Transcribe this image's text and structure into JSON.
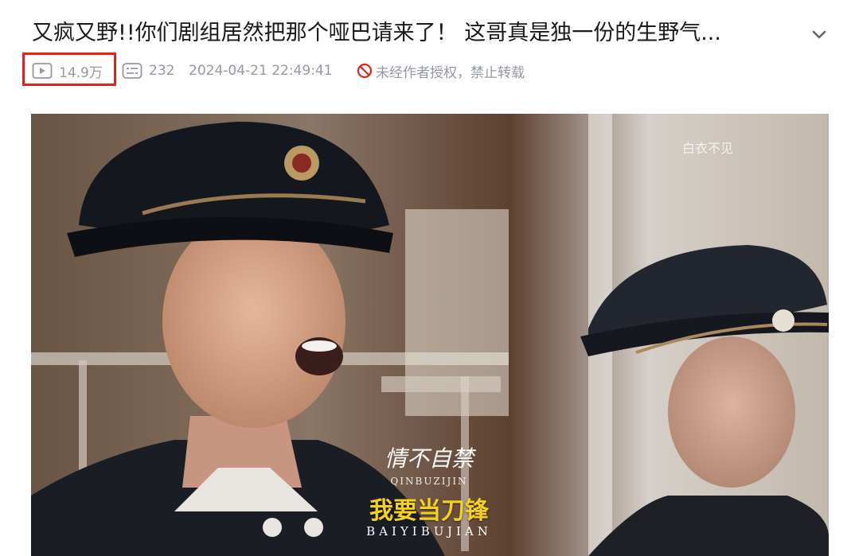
{
  "title": "又疯又野!!你们剧组居然把那个哑巴请来了！ 这哥真是独一份的生野气...",
  "meta": {
    "views": "14.9万",
    "danmaku": "232",
    "datetime": "2024-04-21 22:49:41",
    "copyright": "未经作者授权，禁止转载"
  },
  "video": {
    "watermark": "白衣不见",
    "caption_top": "情不自禁",
    "caption_top_pinyin": "QINBUZIJIN",
    "caption_main": "我要当刀锋",
    "caption_main_pinyin": "BAIYIBUJIAN"
  },
  "colors": {
    "highlight_border": "#e2231a",
    "meta_text": "#9499a0",
    "forbid_icon": "#e2231a",
    "caption_yellow": "#f4d21a"
  }
}
